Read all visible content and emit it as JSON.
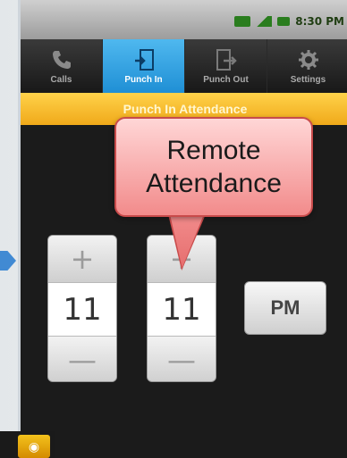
{
  "status_bar": {
    "time": "8:30 PM"
  },
  "tabs": [
    {
      "label": "Calls",
      "icon": "phone-icon"
    },
    {
      "label": "Punch In",
      "icon": "punch-in-icon",
      "active": true
    },
    {
      "label": "Punch Out",
      "icon": "punch-out-icon"
    },
    {
      "label": "Settings",
      "icon": "gear-icon"
    }
  ],
  "title_strip": {
    "text": "Punch In Attendance"
  },
  "time_picker": {
    "hour": "11",
    "minute": "11",
    "ampm": "PM",
    "increment_symbol": "+",
    "decrement_symbol": "—"
  },
  "callout": {
    "text": "Remote Attendance"
  },
  "colors": {
    "active_tab": "#1f8fd5",
    "title_strip": "#f0a91a",
    "callout_fill": "#f28b8b",
    "callout_border": "#c84b4b"
  }
}
